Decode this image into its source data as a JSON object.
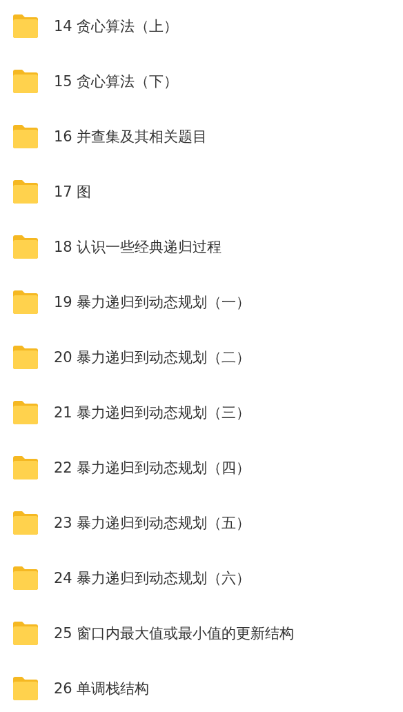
{
  "folders": [
    {
      "name": "14 贪心算法（上）"
    },
    {
      "name": "15 贪心算法（下）"
    },
    {
      "name": "16 并查集及其相关题目"
    },
    {
      "name": "17 图"
    },
    {
      "name": "18 认识一些经典递归过程"
    },
    {
      "name": "19 暴力递归到动态规划（一）"
    },
    {
      "name": "20 暴力递归到动态规划（二）"
    },
    {
      "name": "21 暴力递归到动态规划（三）"
    },
    {
      "name": "22 暴力递归到动态规划（四）"
    },
    {
      "name": "23 暴力递归到动态规划（五）"
    },
    {
      "name": "24 暴力递归到动态规划（六）"
    },
    {
      "name": "25 窗口内最大值或最小值的更新结构"
    },
    {
      "name": "26 单调栈结构"
    }
  ]
}
